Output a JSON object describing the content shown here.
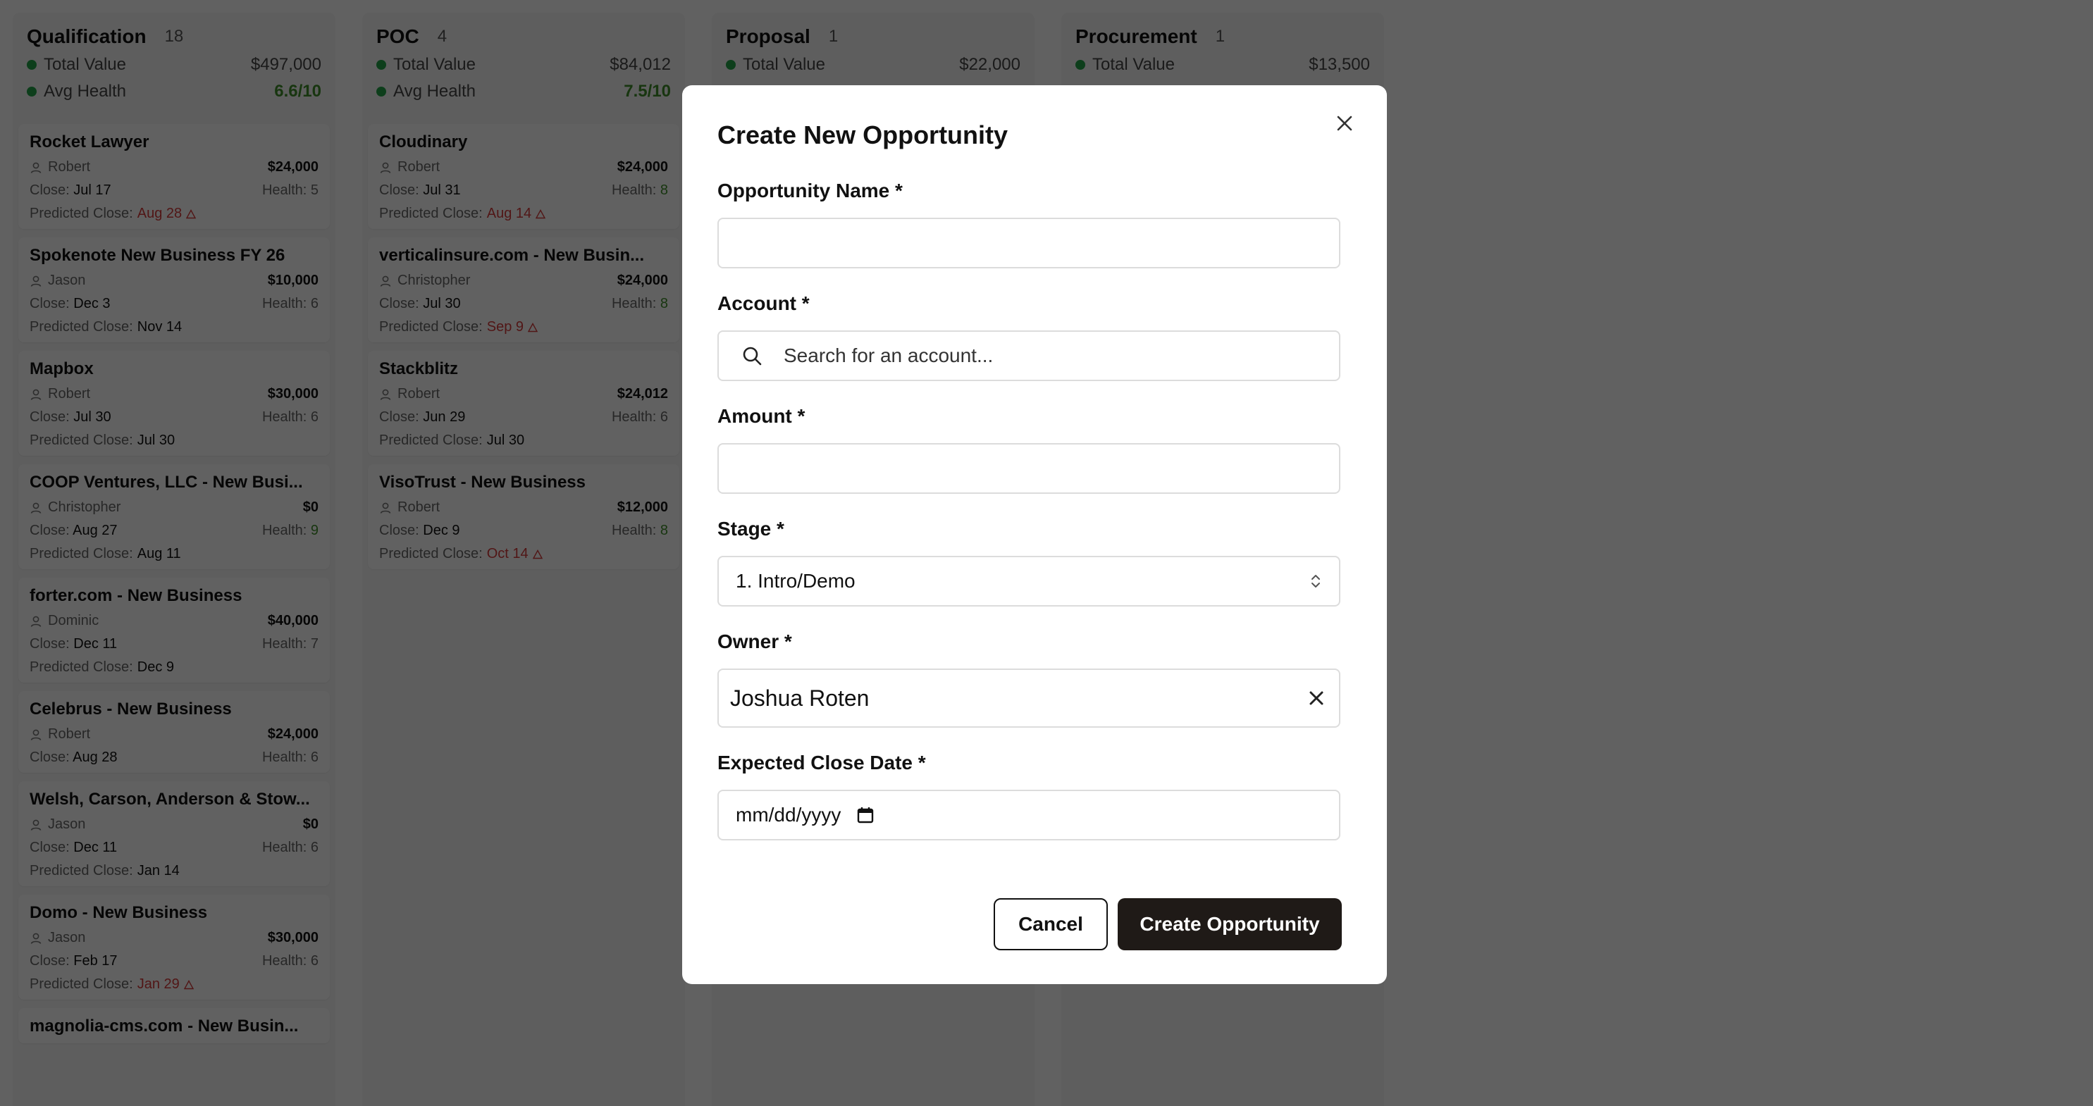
{
  "columns": [
    {
      "name": "Qualification",
      "count": "18",
      "total_label": "Total Value",
      "total": "$497,000",
      "health_label": "Avg Health",
      "health": "6.6/10",
      "cards": [
        {
          "title": "Rocket Lawyer",
          "owner": "Robert",
          "amount": "$24,000",
          "close_label": "Close:",
          "close": "Jul 17",
          "health_label": "Health:",
          "health": "5",
          "predicted_label": "Predicted Close:",
          "predicted": "Aug 28",
          "late": true
        },
        {
          "title": "Spokenote New Business FY 26",
          "owner": "Jason",
          "amount": "$10,000",
          "close_label": "Close:",
          "close": "Dec 3",
          "health_label": "Health:",
          "health": "6",
          "predicted_label": "Predicted Close:",
          "predicted": "Nov 14",
          "late": false
        },
        {
          "title": "Mapbox",
          "owner": "Robert",
          "amount": "$30,000",
          "close_label": "Close:",
          "close": "Jul 30",
          "health_label": "Health:",
          "health": "6",
          "predicted_label": "Predicted Close:",
          "predicted": "Jul 30",
          "late": false
        },
        {
          "title": "COOP Ventures, LLC - New Busi...",
          "owner": "Christopher",
          "amount": "$0",
          "close_label": "Close:",
          "close": "Aug 27",
          "health_label": "Health:",
          "health": "9",
          "predicted_label": "Predicted Close:",
          "predicted": "Aug 11",
          "late": false
        },
        {
          "title": "forter.com - New Business",
          "owner": "Dominic",
          "amount": "$40,000",
          "close_label": "Close:",
          "close": "Dec 11",
          "health_label": "Health:",
          "health": "7",
          "predicted_label": "Predicted Close:",
          "predicted": "Dec 9",
          "late": false
        },
        {
          "title": "Celebrus - New Business",
          "owner": "Robert",
          "amount": "$24,000",
          "close_label": "Close:",
          "close": "Aug 28",
          "health_label": "Health:",
          "health": "6"
        },
        {
          "title": "Welsh, Carson, Anderson & Stow...",
          "owner": "Jason",
          "amount": "$0",
          "close_label": "Close:",
          "close": "Dec 11",
          "health_label": "Health:",
          "health": "6",
          "predicted_label": "Predicted Close:",
          "predicted": "Jan 14",
          "late": false
        },
        {
          "title": "Domo - New Business",
          "owner": "Jason",
          "amount": "$30,000",
          "close_label": "Close:",
          "close": "Feb 17",
          "health_label": "Health:",
          "health": "6",
          "predicted_label": "Predicted Close:",
          "predicted": "Jan 29",
          "late": true
        },
        {
          "title": "magnolia-cms.com - New Busin..."
        }
      ]
    },
    {
      "name": "POC",
      "count": "4",
      "total_label": "Total Value",
      "total": "$84,012",
      "health_label": "Avg Health",
      "health": "7.5/10",
      "cards": [
        {
          "title": "Cloudinary",
          "owner": "Robert",
          "amount": "$24,000",
          "close_label": "Close:",
          "close": "Jul 31",
          "health_label": "Health:",
          "health": "8",
          "predicted_label": "Predicted Close:",
          "predicted": "Aug 14",
          "late": true
        },
        {
          "title": "verticalinsure.com - New Busin...",
          "owner": "Christopher",
          "amount": "$24,000",
          "close_label": "Close:",
          "close": "Jul 30",
          "health_label": "Health:",
          "health": "8",
          "predicted_label": "Predicted Close:",
          "predicted": "Sep 9",
          "late": true
        },
        {
          "title": "Stackblitz",
          "owner": "Robert",
          "amount": "$24,012",
          "close_label": "Close:",
          "close": "Jun 29",
          "health_label": "Health:",
          "health": "6",
          "predicted_label": "Predicted Close:",
          "predicted": "Jul 30",
          "late": false
        },
        {
          "title": "VisoTrust - New Business",
          "owner": "Robert",
          "amount": "$12,000",
          "close_label": "Close:",
          "close": "Dec 9",
          "health_label": "Health:",
          "health": "8",
          "predicted_label": "Predicted Close:",
          "predicted": "Oct 14",
          "late": true
        }
      ]
    },
    {
      "name": "Proposal",
      "count": "1",
      "total_label": "Total Value",
      "total": "$22,000",
      "cards": []
    },
    {
      "name": "Procurement",
      "count": "1",
      "total_label": "Total Value",
      "total": "$13,500",
      "cards": []
    }
  ],
  "modal": {
    "title": "Create New Opportunity",
    "name_label": "Opportunity Name *",
    "name_value": "",
    "account_label": "Account *",
    "account_placeholder": "Search for an account...",
    "amount_label": "Amount *",
    "amount_value": "",
    "stage_label": "Stage *",
    "stage_value": "1. Intro/Demo",
    "owner_label": "Owner *",
    "owner_value": "Joshua Roten",
    "date_label": "Expected Close Date *",
    "date_placeholder": "mm/dd/yyyy",
    "cancel_label": "Cancel",
    "create_label": "Create Opportunity"
  },
  "colors": {
    "health_dot": "#22a447",
    "late": "#d63b3b",
    "primary_button": "#1f1a17"
  }
}
